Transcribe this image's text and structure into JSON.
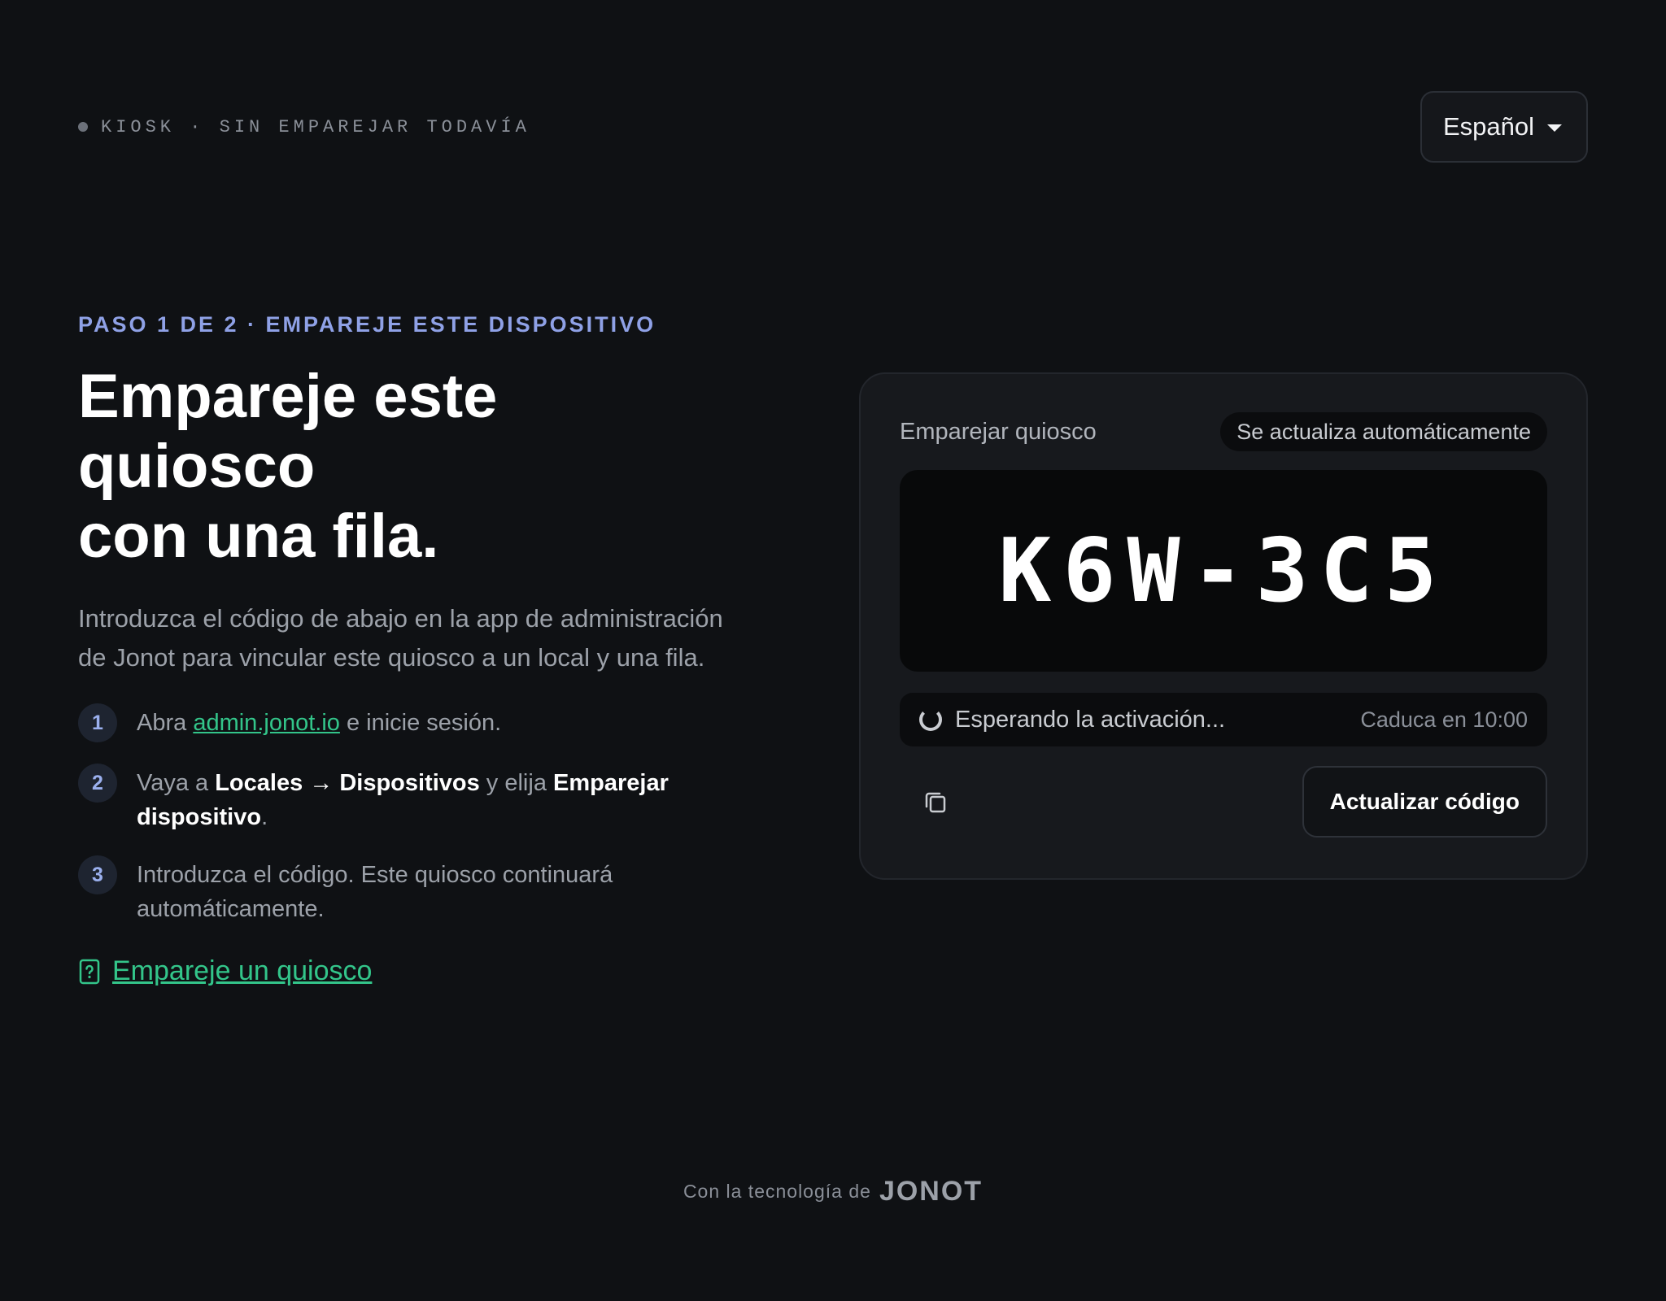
{
  "header": {
    "status_text": "KIOSK · SIN EMPAREJAR TODAVÍA",
    "language": {
      "selected": "Español",
      "icon": "chevron-down-icon"
    }
  },
  "intro": {
    "eyebrow": "PASO 1 DE 2 · EMPAREJE ESTE DISPOSITIVO",
    "title_line1": "Empareje este quiosco",
    "title_line2": "con una fila.",
    "lead": "Introduzca el código de abajo en la app de administración de Jonot para vincular este quiosco a un local y una fila."
  },
  "steps": [
    {
      "num": "1",
      "before": "Abra ",
      "link": "admin.jonot.io",
      "after": " e inicie sesión."
    },
    {
      "num": "2",
      "before": "Vaya a ",
      "b1": "Locales → Dispositivos",
      "mid": " y elija ",
      "b2": "Emparejar dispositivo",
      "after": "."
    },
    {
      "num": "3",
      "text": "Introduzca el código. Este quiosco continuará automáticamente."
    }
  ],
  "help_link": {
    "label": "Empareje un quiosco",
    "icon": "help-document-icon"
  },
  "card": {
    "title": "Emparejar quiosco",
    "badge": "Se actualiza automáticamente",
    "code": "K6W-3C5",
    "waiting": "Esperando la activación...",
    "expires": "Caduca en 10:00",
    "copy_icon": "copy-icon",
    "refresh_label": "Actualizar código"
  },
  "footer": {
    "prefix": "Con la tecnología de",
    "brand": "JONOT"
  },
  "colors": {
    "background": "#0f1114",
    "accent_green": "#33c58a",
    "accent_blue": "#8fa1e6",
    "card": "#17191d"
  }
}
